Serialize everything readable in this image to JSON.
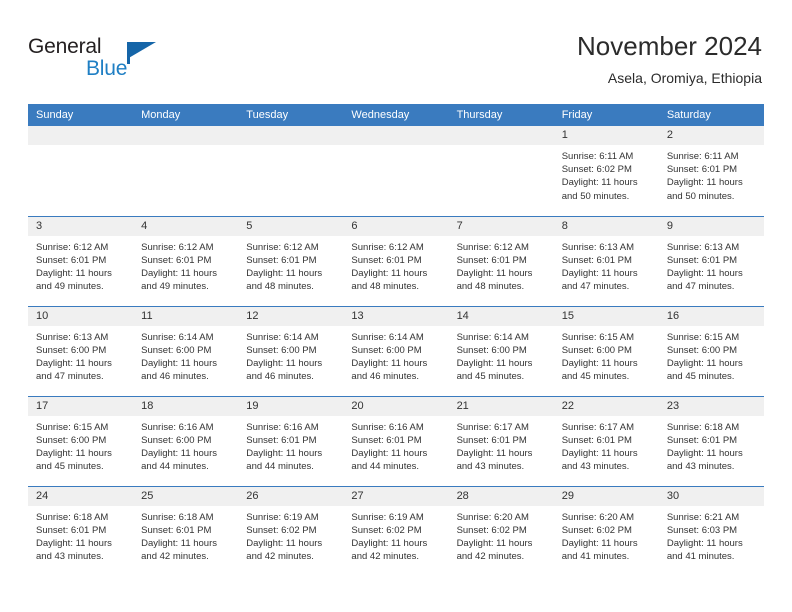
{
  "brand": {
    "name_part1": "General",
    "name_part2": "Blue",
    "flag_icon": "triangle-flag-icon",
    "accent_color": "#1565a8"
  },
  "header": {
    "title": "November 2024",
    "location": "Asela, Oromiya, Ethiopia"
  },
  "theme": {
    "header_bg": "#3a7bbf",
    "daynum_band_bg": "#f0f0f0",
    "grid_line": "#3a7bbf",
    "text": "#333333"
  },
  "weekdays": [
    "Sunday",
    "Monday",
    "Tuesday",
    "Wednesday",
    "Thursday",
    "Friday",
    "Saturday"
  ],
  "labels": {
    "sunrise_prefix": "Sunrise: ",
    "sunset_prefix": "Sunset: ",
    "daylight_prefix": "Daylight: "
  },
  "weeks": [
    [
      {
        "day": "",
        "sunrise": "",
        "sunset": "",
        "daylight_line1": "",
        "daylight_line2": ""
      },
      {
        "day": "",
        "sunrise": "",
        "sunset": "",
        "daylight_line1": "",
        "daylight_line2": ""
      },
      {
        "day": "",
        "sunrise": "",
        "sunset": "",
        "daylight_line1": "",
        "daylight_line2": ""
      },
      {
        "day": "",
        "sunrise": "",
        "sunset": "",
        "daylight_line1": "",
        "daylight_line2": ""
      },
      {
        "day": "",
        "sunrise": "",
        "sunset": "",
        "daylight_line1": "",
        "daylight_line2": ""
      },
      {
        "day": "1",
        "sunrise": "Sunrise: 6:11 AM",
        "sunset": "Sunset: 6:02 PM",
        "daylight_line1": "Daylight: 11 hours",
        "daylight_line2": "and 50 minutes."
      },
      {
        "day": "2",
        "sunrise": "Sunrise: 6:11 AM",
        "sunset": "Sunset: 6:01 PM",
        "daylight_line1": "Daylight: 11 hours",
        "daylight_line2": "and 50 minutes."
      }
    ],
    [
      {
        "day": "3",
        "sunrise": "Sunrise: 6:12 AM",
        "sunset": "Sunset: 6:01 PM",
        "daylight_line1": "Daylight: 11 hours",
        "daylight_line2": "and 49 minutes."
      },
      {
        "day": "4",
        "sunrise": "Sunrise: 6:12 AM",
        "sunset": "Sunset: 6:01 PM",
        "daylight_line1": "Daylight: 11 hours",
        "daylight_line2": "and 49 minutes."
      },
      {
        "day": "5",
        "sunrise": "Sunrise: 6:12 AM",
        "sunset": "Sunset: 6:01 PM",
        "daylight_line1": "Daylight: 11 hours",
        "daylight_line2": "and 48 minutes."
      },
      {
        "day": "6",
        "sunrise": "Sunrise: 6:12 AM",
        "sunset": "Sunset: 6:01 PM",
        "daylight_line1": "Daylight: 11 hours",
        "daylight_line2": "and 48 minutes."
      },
      {
        "day": "7",
        "sunrise": "Sunrise: 6:12 AM",
        "sunset": "Sunset: 6:01 PM",
        "daylight_line1": "Daylight: 11 hours",
        "daylight_line2": "and 48 minutes."
      },
      {
        "day": "8",
        "sunrise": "Sunrise: 6:13 AM",
        "sunset": "Sunset: 6:01 PM",
        "daylight_line1": "Daylight: 11 hours",
        "daylight_line2": "and 47 minutes."
      },
      {
        "day": "9",
        "sunrise": "Sunrise: 6:13 AM",
        "sunset": "Sunset: 6:01 PM",
        "daylight_line1": "Daylight: 11 hours",
        "daylight_line2": "and 47 minutes."
      }
    ],
    [
      {
        "day": "10",
        "sunrise": "Sunrise: 6:13 AM",
        "sunset": "Sunset: 6:00 PM",
        "daylight_line1": "Daylight: 11 hours",
        "daylight_line2": "and 47 minutes."
      },
      {
        "day": "11",
        "sunrise": "Sunrise: 6:14 AM",
        "sunset": "Sunset: 6:00 PM",
        "daylight_line1": "Daylight: 11 hours",
        "daylight_line2": "and 46 minutes."
      },
      {
        "day": "12",
        "sunrise": "Sunrise: 6:14 AM",
        "sunset": "Sunset: 6:00 PM",
        "daylight_line1": "Daylight: 11 hours",
        "daylight_line2": "and 46 minutes."
      },
      {
        "day": "13",
        "sunrise": "Sunrise: 6:14 AM",
        "sunset": "Sunset: 6:00 PM",
        "daylight_line1": "Daylight: 11 hours",
        "daylight_line2": "and 46 minutes."
      },
      {
        "day": "14",
        "sunrise": "Sunrise: 6:14 AM",
        "sunset": "Sunset: 6:00 PM",
        "daylight_line1": "Daylight: 11 hours",
        "daylight_line2": "and 45 minutes."
      },
      {
        "day": "15",
        "sunrise": "Sunrise: 6:15 AM",
        "sunset": "Sunset: 6:00 PM",
        "daylight_line1": "Daylight: 11 hours",
        "daylight_line2": "and 45 minutes."
      },
      {
        "day": "16",
        "sunrise": "Sunrise: 6:15 AM",
        "sunset": "Sunset: 6:00 PM",
        "daylight_line1": "Daylight: 11 hours",
        "daylight_line2": "and 45 minutes."
      }
    ],
    [
      {
        "day": "17",
        "sunrise": "Sunrise: 6:15 AM",
        "sunset": "Sunset: 6:00 PM",
        "daylight_line1": "Daylight: 11 hours",
        "daylight_line2": "and 45 minutes."
      },
      {
        "day": "18",
        "sunrise": "Sunrise: 6:16 AM",
        "sunset": "Sunset: 6:00 PM",
        "daylight_line1": "Daylight: 11 hours",
        "daylight_line2": "and 44 minutes."
      },
      {
        "day": "19",
        "sunrise": "Sunrise: 6:16 AM",
        "sunset": "Sunset: 6:01 PM",
        "daylight_line1": "Daylight: 11 hours",
        "daylight_line2": "and 44 minutes."
      },
      {
        "day": "20",
        "sunrise": "Sunrise: 6:16 AM",
        "sunset": "Sunset: 6:01 PM",
        "daylight_line1": "Daylight: 11 hours",
        "daylight_line2": "and 44 minutes."
      },
      {
        "day": "21",
        "sunrise": "Sunrise: 6:17 AM",
        "sunset": "Sunset: 6:01 PM",
        "daylight_line1": "Daylight: 11 hours",
        "daylight_line2": "and 43 minutes."
      },
      {
        "day": "22",
        "sunrise": "Sunrise: 6:17 AM",
        "sunset": "Sunset: 6:01 PM",
        "daylight_line1": "Daylight: 11 hours",
        "daylight_line2": "and 43 minutes."
      },
      {
        "day": "23",
        "sunrise": "Sunrise: 6:18 AM",
        "sunset": "Sunset: 6:01 PM",
        "daylight_line1": "Daylight: 11 hours",
        "daylight_line2": "and 43 minutes."
      }
    ],
    [
      {
        "day": "24",
        "sunrise": "Sunrise: 6:18 AM",
        "sunset": "Sunset: 6:01 PM",
        "daylight_line1": "Daylight: 11 hours",
        "daylight_line2": "and 43 minutes."
      },
      {
        "day": "25",
        "sunrise": "Sunrise: 6:18 AM",
        "sunset": "Sunset: 6:01 PM",
        "daylight_line1": "Daylight: 11 hours",
        "daylight_line2": "and 42 minutes."
      },
      {
        "day": "26",
        "sunrise": "Sunrise: 6:19 AM",
        "sunset": "Sunset: 6:02 PM",
        "daylight_line1": "Daylight: 11 hours",
        "daylight_line2": "and 42 minutes."
      },
      {
        "day": "27",
        "sunrise": "Sunrise: 6:19 AM",
        "sunset": "Sunset: 6:02 PM",
        "daylight_line1": "Daylight: 11 hours",
        "daylight_line2": "and 42 minutes."
      },
      {
        "day": "28",
        "sunrise": "Sunrise: 6:20 AM",
        "sunset": "Sunset: 6:02 PM",
        "daylight_line1": "Daylight: 11 hours",
        "daylight_line2": "and 42 minutes."
      },
      {
        "day": "29",
        "sunrise": "Sunrise: 6:20 AM",
        "sunset": "Sunset: 6:02 PM",
        "daylight_line1": "Daylight: 11 hours",
        "daylight_line2": "and 41 minutes."
      },
      {
        "day": "30",
        "sunrise": "Sunrise: 6:21 AM",
        "sunset": "Sunset: 6:03 PM",
        "daylight_line1": "Daylight: 11 hours",
        "daylight_line2": "and 41 minutes."
      }
    ]
  ]
}
